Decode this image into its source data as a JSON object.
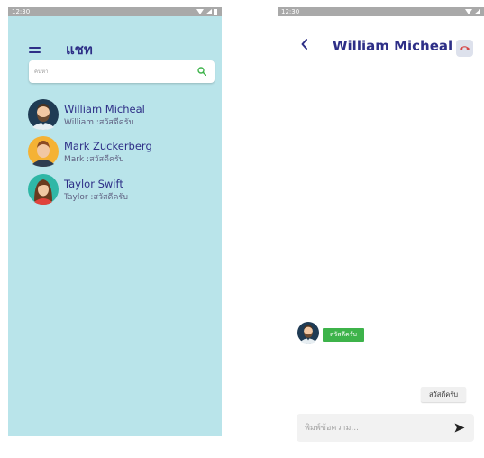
{
  "left_screen": {
    "status_bar": {
      "time": "12:30"
    },
    "header": {
      "title": "แชท",
      "menu_icon": "hamburger-icon"
    },
    "search": {
      "placeholder": "ค้นหา",
      "icon": "search-icon"
    },
    "contacts": [
      {
        "name": "William Micheal",
        "last_message": "William :สวัสดีครับ",
        "avatar": "man-beard-avatar"
      },
      {
        "name": "Mark Zuckerberg",
        "last_message": "Mark :สวัสดีครับ",
        "avatar": "man-avatar"
      },
      {
        "name": "Taylor Swift",
        "last_message": "Taylor :สวัสดีครับ",
        "avatar": "woman-avatar"
      }
    ]
  },
  "right_screen": {
    "status_bar": {
      "time": "12:30"
    },
    "header": {
      "title": "William Micheal",
      "back_icon": "chevron-left-icon",
      "call_icon": "phone-hangup-icon"
    },
    "messages": [
      {
        "direction": "incoming",
        "text": "สวัสดีครับ"
      },
      {
        "direction": "outgoing",
        "text": "สวัสดีครับ"
      }
    ],
    "composer": {
      "placeholder": "พิมพ์ข้อความ...",
      "send_icon": "send-icon"
    }
  },
  "colors": {
    "chat_list_bg": "#b9e4ea",
    "title": "#2e2f87",
    "status_bar": "#a9a9a9",
    "incoming_bubble": "#3db34a",
    "outgoing_bubble": "#f0f0f0",
    "search_icon": "#3db34a"
  }
}
